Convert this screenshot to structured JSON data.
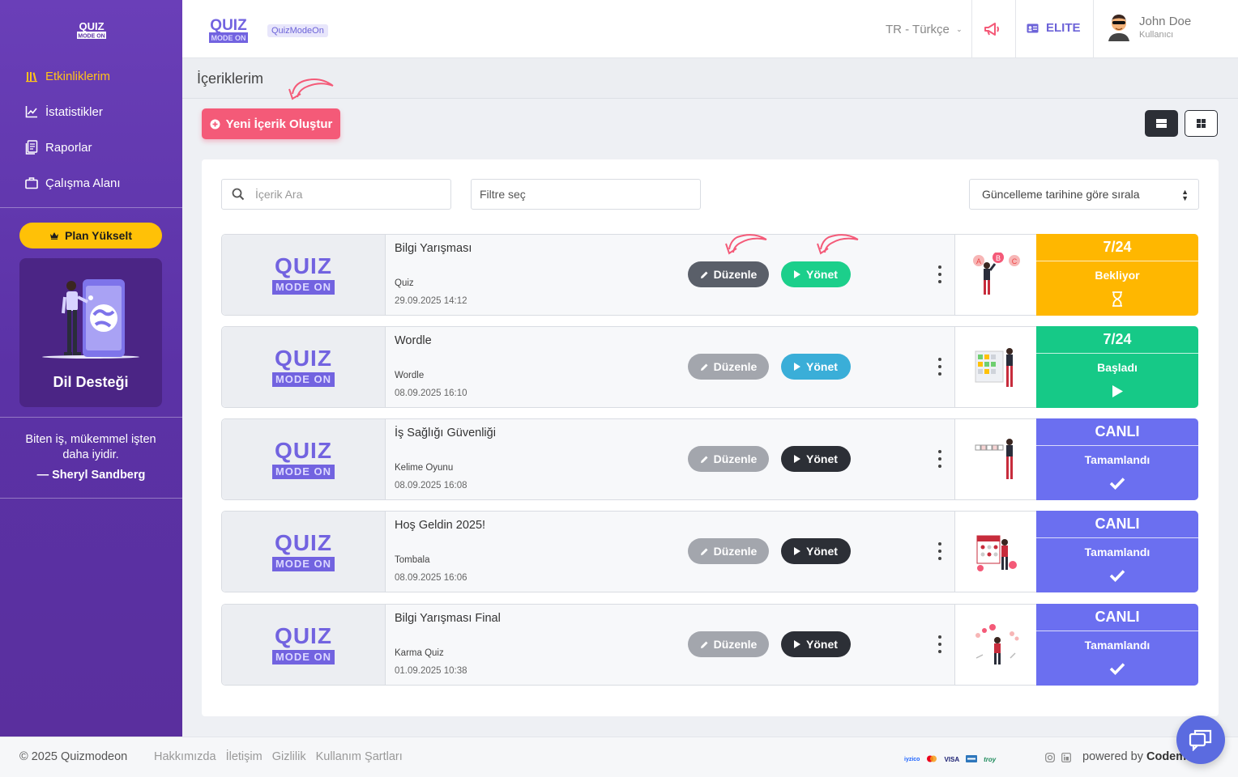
{
  "brand": {
    "logo_top": "QUIZ",
    "logo_bottom": "MODE ON",
    "site_badge": "QuizModeOn"
  },
  "sidebar": {
    "items": [
      {
        "label": "Etkinliklerim",
        "icon": "library-icon",
        "active": true
      },
      {
        "label": "İstatistikler",
        "icon": "chart-line-icon"
      },
      {
        "label": "Raporlar",
        "icon": "report-icon"
      },
      {
        "label": "Çalışma Alanı",
        "icon": "briefcase-icon"
      }
    ],
    "plan_button": "Plan Yükselt",
    "promo_title": "Dil Desteği",
    "quote_text": "Biten iş, mükemmel işten daha iyidir.",
    "quote_author": "— Sheryl Sandberg"
  },
  "header": {
    "language": "TR - Türkçe",
    "plan": "ELITE",
    "user_name": "John Doe",
    "user_role": "Kullanıcı"
  },
  "page": {
    "title": "İçeriklerim",
    "new_button": "Yeni İçerik Oluştur"
  },
  "filters": {
    "search_placeholder": "İçerik Ara",
    "filter_placeholder": "Filtre seç",
    "sort_label": "Güncelleme tarihine göre sırala"
  },
  "actions": {
    "edit": "Düzenle",
    "manage": "Yönet"
  },
  "rows": [
    {
      "title": "Bilgi Yarışması",
      "type": "Quiz",
      "date": "29.09.2025 14:12",
      "status_top": "7/24",
      "status_label": "Bekliyor",
      "status_color": "#ffb700",
      "manage_color": "#1ccf8b",
      "edit_color": "#5a5f69",
      "status_icon": "hourglass-icon"
    },
    {
      "title": "Wordle",
      "type": "Wordle",
      "date": "08.09.2025 16:10",
      "status_top": "7/24",
      "status_label": "Başladı",
      "status_color": "#16c987",
      "manage_color": "#3aaed8",
      "edit_color": "#a3a6ad",
      "status_icon": "play-icon"
    },
    {
      "title": "İş Sağlığı Güvenliği",
      "type": "Kelime Oyunu",
      "date": "08.09.2025 16:08",
      "status_top": "CANLI",
      "status_label": "Tamamlandı",
      "status_color": "#6b6ff0",
      "manage_color": "#2c2f36",
      "edit_color": "#a3a6ad",
      "status_icon": "check-icon"
    },
    {
      "title": "Hoş Geldin 2025!",
      "type": "Tombala",
      "date": "08.09.2025 16:06",
      "status_top": "CANLI",
      "status_label": "Tamamlandı",
      "status_color": "#6b6ff0",
      "manage_color": "#2c2f36",
      "edit_color": "#a3a6ad",
      "status_icon": "check-icon"
    },
    {
      "title": "Bilgi Yarışması Final",
      "type": "Karma Quiz",
      "date": "01.09.2025 10:38",
      "status_top": "CANLI",
      "status_label": "Tamamlandı",
      "status_color": "#6b6ff0",
      "manage_color": "#2c2f36",
      "edit_color": "#a3a6ad",
      "status_icon": "check-icon"
    }
  ],
  "footer": {
    "copyright": "© 2025 Quizmodeon",
    "links": [
      "Hakkımızda",
      "İletişim",
      "Gizlilik",
      "Kullanım Şartları"
    ],
    "payments": [
      "iyzico",
      "mastercard",
      "VISA",
      "amex",
      "troy"
    ],
    "powered_prefix": "powered by",
    "powered_brand": "Codem"
  },
  "colors": {
    "sidebar": "#5b32a6",
    "accent": "#6c63d8",
    "primary_pink": "#f45a78",
    "active_nav": "#ffc21a"
  }
}
